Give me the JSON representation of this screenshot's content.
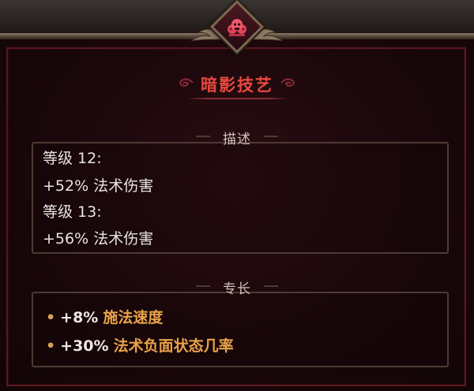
{
  "tooltip": {
    "title": "暗影技艺",
    "description": {
      "header": "描述",
      "lines": [
        "等级 12:",
        "+52% 法术伤害",
        "等级 13:",
        "+56% 法术伤害"
      ]
    },
    "specialties": {
      "header": "专长",
      "items": [
        {
          "value": "+8%",
          "name": "施法速度"
        },
        {
          "value": "+30%",
          "name": "法术负面状态几率"
        }
      ]
    }
  },
  "colors": {
    "title": "#e8483e",
    "specialty_name": "#e9a34a",
    "border": "#5a1620",
    "frame_gold": "#7a6652"
  },
  "icons": [
    "skull-crest-icon"
  ]
}
